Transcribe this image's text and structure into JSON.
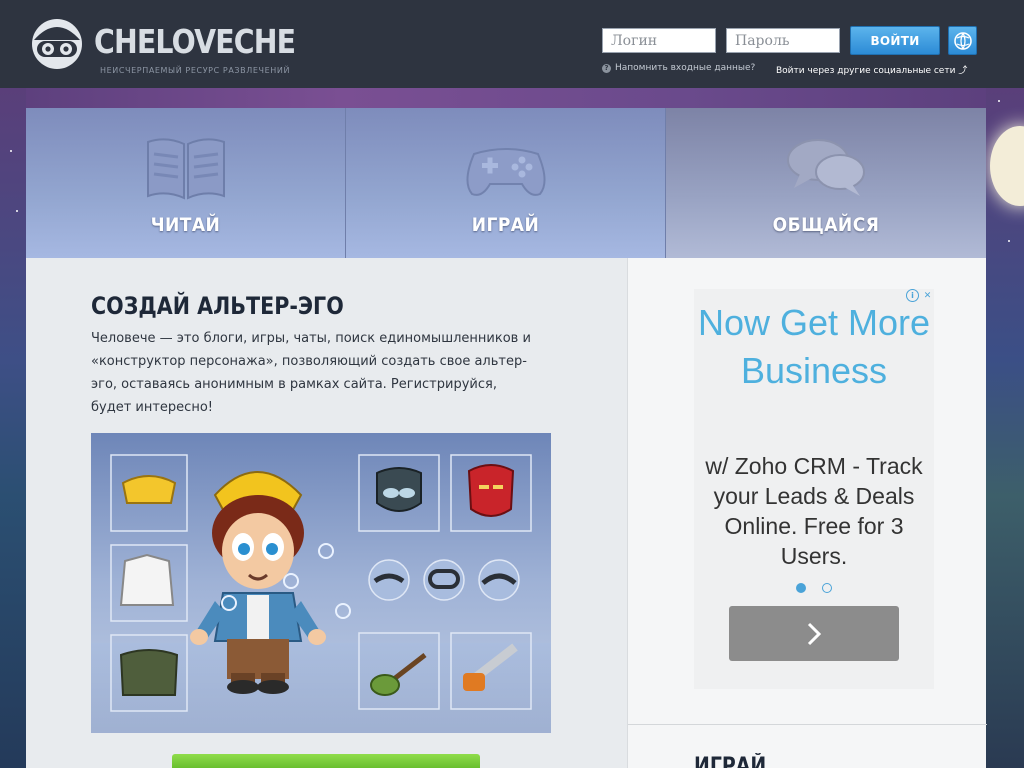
{
  "header": {
    "logo_text": "CHELOVECHE",
    "tagline": "НЕИСЧЕРПАЕМЫЙ РЕСУРС РАЗВЛЕЧЕНИЙ",
    "login_placeholder": "Логин",
    "password_placeholder": "Пароль",
    "login_button": "ВОЙТИ",
    "remind_link": "Напомнить входные данные?",
    "social_link": "Войти через другие социальные сети"
  },
  "tiles": [
    {
      "label": "ЧИТАЙ",
      "icon": "book-icon"
    },
    {
      "label": "ИГРАЙ",
      "icon": "gamepad-icon"
    },
    {
      "label": "ОБЩАЙСЯ",
      "icon": "chat-bubbles-icon"
    }
  ],
  "main": {
    "title": "СОЗДАЙ АЛЬТЕР-ЭГО",
    "description": "Человече — это блоги, игры, чаты, поиск единомышленников и «конструктор персонажа», позволяющий создать свое альтер-эго, оставаясь анонимным в рамках сайта. Регистрируйся, будет интересно!"
  },
  "ad": {
    "headline": "Now Get More Business",
    "body": "w/ Zoho CRM - Track your Leads & Deals Online. Free for 3 Users.",
    "slides": 2,
    "active_slide": 1
  },
  "sidebar": {
    "title": "ИГРАЙ"
  },
  "colors": {
    "header_bg": "#2e3440",
    "accent_blue": "#2c8bd6",
    "ad_headline": "#4eb0de",
    "cta_green": "#58b324"
  }
}
